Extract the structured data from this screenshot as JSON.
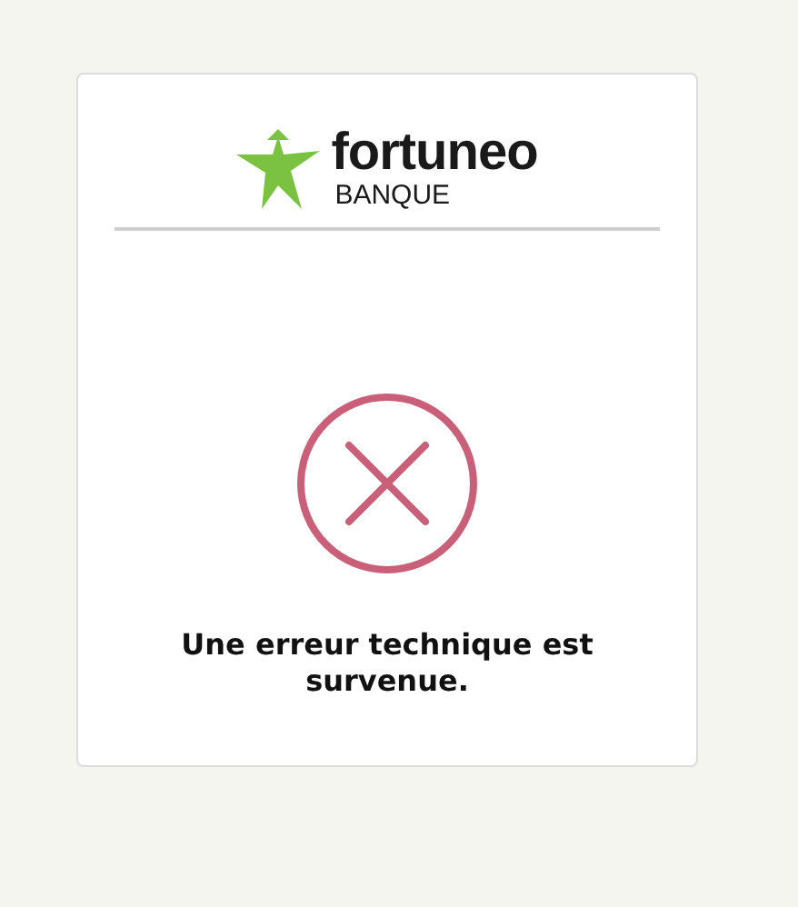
{
  "logo": {
    "name": "fortuneo",
    "tagline": "BANQUE"
  },
  "error": {
    "message": "Une erreur technique est survenue."
  }
}
